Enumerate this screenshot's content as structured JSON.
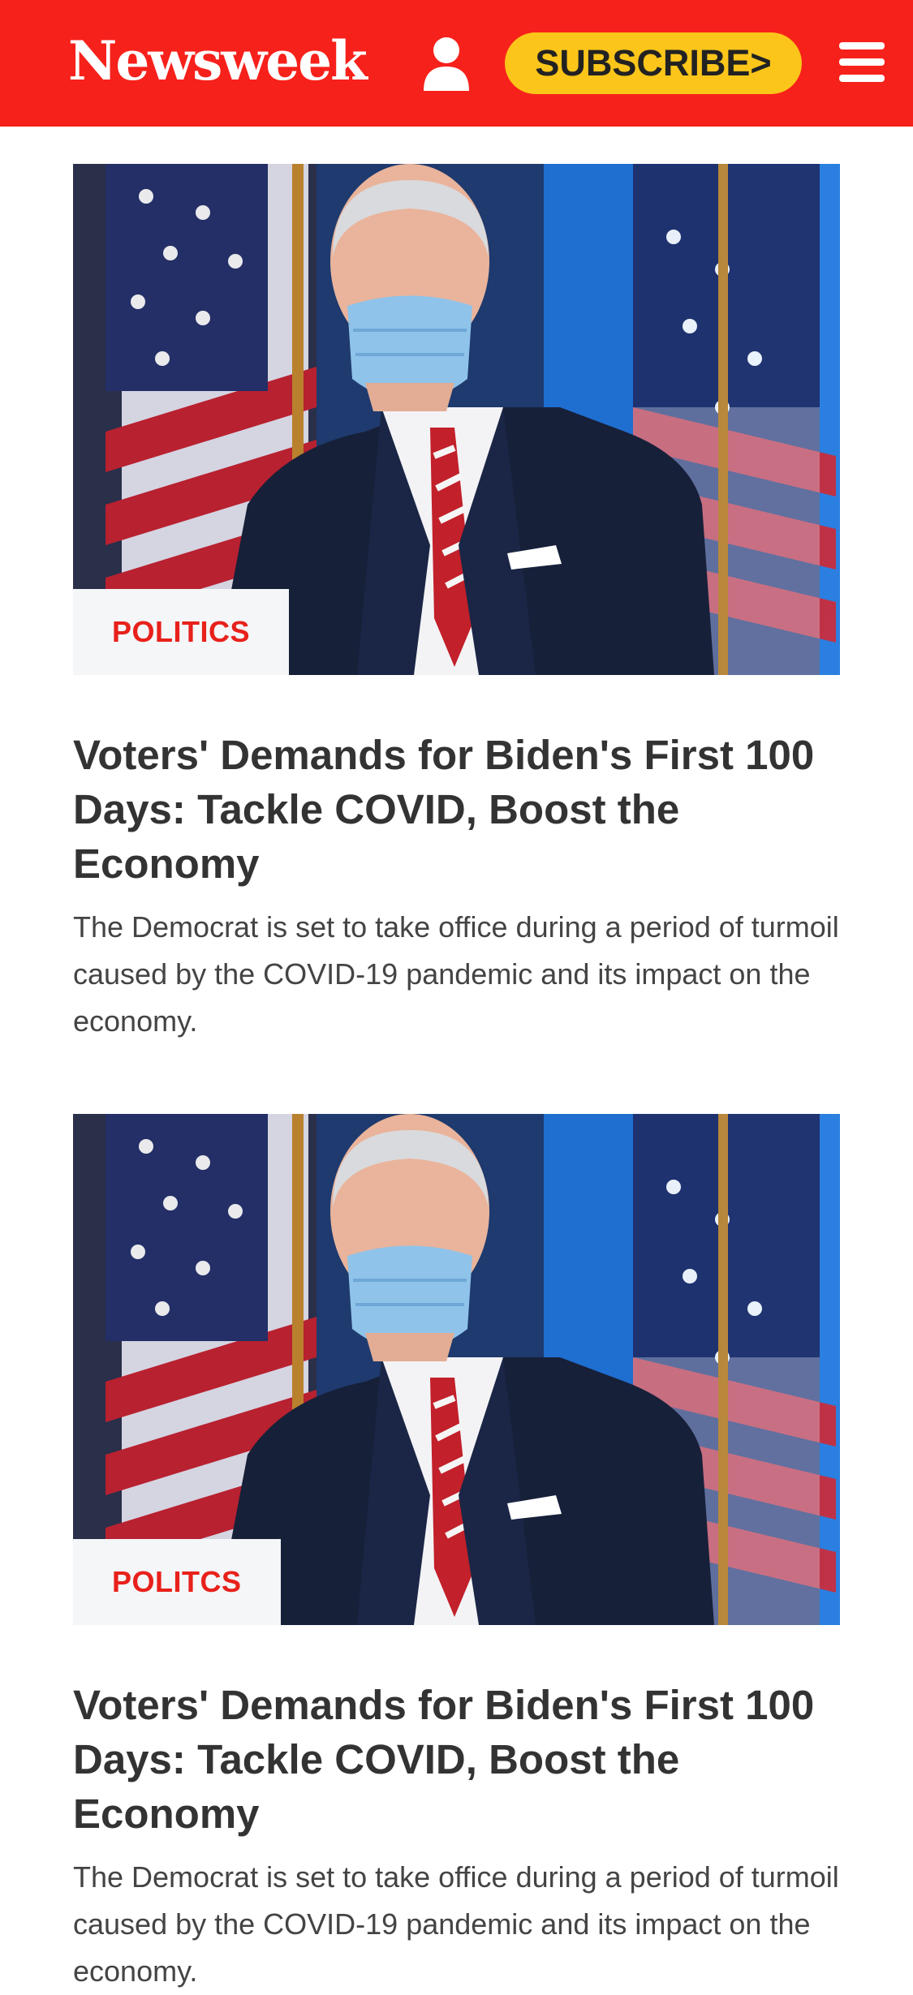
{
  "header": {
    "logo_text": "Newsweek",
    "subscribe_label": "SUBSCRIBE>",
    "brand_color": "#f7211b",
    "subscribe_color": "#fbc51a",
    "icons": [
      "user-icon",
      "hamburger-menu-icon"
    ]
  },
  "articles": [
    {
      "category": "POLITICS",
      "headline": "Voters' Demands for Biden's First 100 Days: Tackle COVID, Boost the Economy",
      "summary": "The Democrat is set to take office during a period of turmoil caused by the COVID-19 pandemic and its impact on the economy."
    },
    {
      "category": "POLITCS",
      "headline": "Voters' Demands for Biden's First 100 Days: Tackle COVID, Boost the Economy",
      "summary": "The Democrat is set to take office during a period of turmoil caused by the COVID-19 pandemic and its impact on the economy."
    }
  ]
}
